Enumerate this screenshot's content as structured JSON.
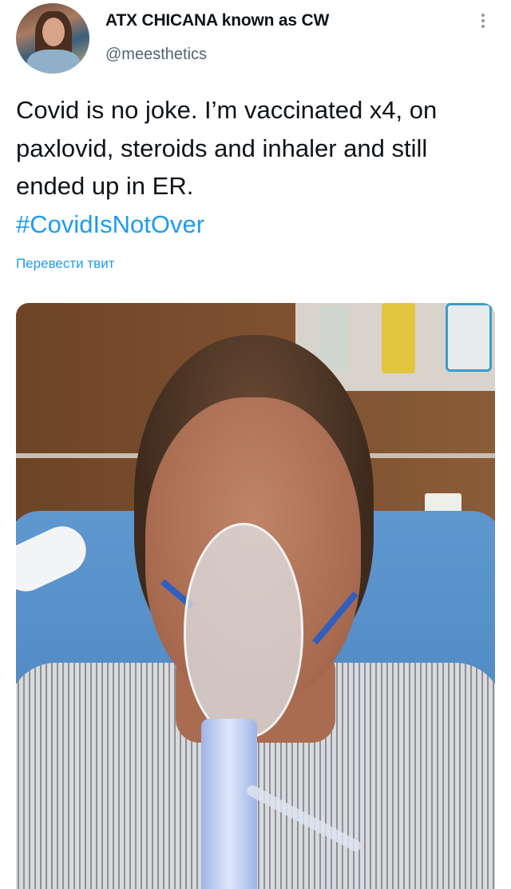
{
  "tweet": {
    "author": {
      "display_name": "ATX CHICANA known as CW",
      "handle": "@meesthetics"
    },
    "text": "Covid is no joke. I’m vaccinated x4, on paxlovid, steroids and inhaler and still ended up in ER.",
    "hashtag": "#CovidIsNotOver",
    "translate_label": "Перевести твит"
  },
  "icons": {
    "more": "more-vertical-icon"
  },
  "colors": {
    "link": "#1d9bf0",
    "secondary_text": "#536471",
    "primary_text": "#0f1419"
  }
}
